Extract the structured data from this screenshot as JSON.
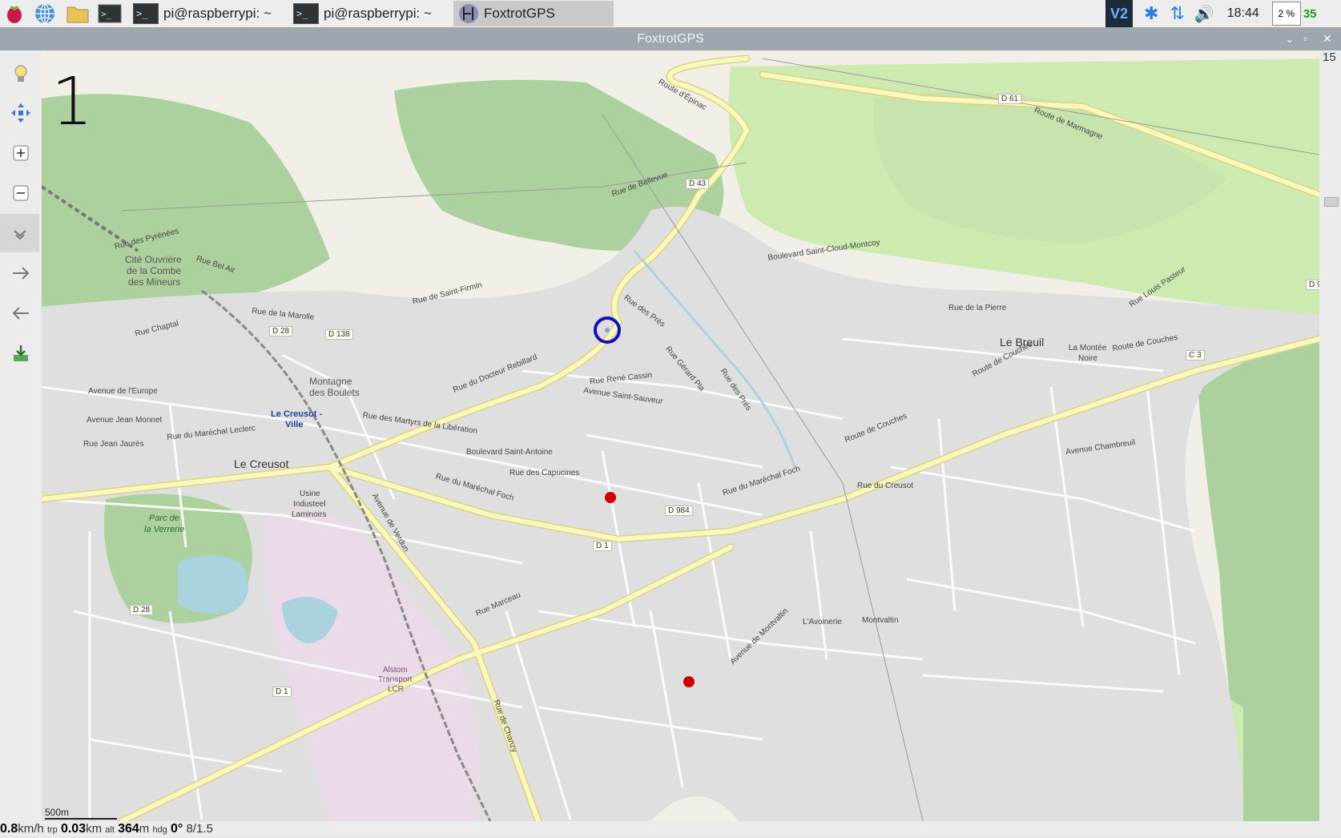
{
  "taskbar": {
    "tasks": [
      {
        "label": "pi@raspberrypi: ~"
      },
      {
        "label": "pi@raspberrypi: ~"
      },
      {
        "label": "FoxtrotGPS"
      }
    ],
    "clock": "18:44",
    "cpu": "2 %",
    "temp": "35"
  },
  "window": {
    "title": "FoxtrotGPS"
  },
  "map": {
    "zoom_level": "1",
    "scale_label": "500m",
    "right_zoom_label": "15",
    "labels": {
      "cite_ouvriere": "Cité Ouvrière",
      "de_la_combe": "de la Combe",
      "des_mineurs": "des Mineurs",
      "le_creusot_ville_1": "Le Creusot -",
      "le_creusot_ville_2": "Ville",
      "le_creusot": "Le Creusot",
      "montagne": "Montagne",
      "des_boulets": "des Boulets",
      "usine_1": "Usine",
      "usine_2": "Industeel",
      "usine_3": "Laminoirs",
      "parc_1": "Parc de",
      "parc_2": "la Verrerie",
      "alstom_1": "Alstom",
      "alstom_2": "Transport",
      "alstom_3": "LCR",
      "le_breuil": "Le Breuil",
      "la_montee_1": "La Montée",
      "la_montee_2": "Noire",
      "lavoinerie": "L'Avoinerie",
      "montvaltin": "Montvaltin",
      "rue_docteur_rebillard": "Rue du Docteur Rebillard",
      "rue_marechal_leclerc": "Rue du Maréchal Leclerc",
      "rue_marechal_foch_1": "Rue du Maréchal Foch",
      "rue_marechal_foch_2": "Rue du Maréchal Foch",
      "rue_jean_jaures": "Rue Jean Jaurès",
      "avenue_saint_sauveur": "Avenue Saint-Sauveur",
      "boulevard_saint_antoine": "Boulevard Saint-Antoine",
      "route_de_couches_1": "Route de Couches",
      "route_de_couches_2": "Route de Couches",
      "route_de_couches_3": "Route de Couches",
      "route_de_marmagne": "Route de Marmagne",
      "boulevard_saint_cloud": "Boulevard Saint-Cloud-Montcoy",
      "rue_marceau": "Rue Marceau",
      "avenue_de_verdun": "Avenue de Verdun",
      "rue_de_chanzy": "Rue de Chanzy",
      "rue_du_creusot": "Rue du Creusot",
      "avenue_de_montvaltin": "Avenue de Montvaltin",
      "rue_chaptal": "Rue Chaptal",
      "rue_des_pres_1": "Rue des Prés",
      "rue_des_pres_2": "Rue des Prés",
      "route_d_epinac": "Route d'Épinac",
      "rue_saint_firmin": "Rue de Saint-Firmin",
      "rue_de_bellevue": "Rue de Bellevue",
      "rue_de_la_marolle": "Rue de la Marolle",
      "rue_des_martyrs": "Rue des Martyrs de la Libération",
      "rue_des_capucines": "Rue des Capucines",
      "rue_rene_cassin": "Rue René Cassin",
      "avenue_jean_monnet": "Avenue Jean Monnet",
      "avenue_de_l_europe": "Avenue de l'Europe",
      "rue_bel_air": "Rue Bel Air",
      "rue_des_pyrenees": "Rue des Pyrénées",
      "rue_de_la_pierre": "Rue de la Pierre",
      "rue_louis_pasteur": "Rue Louis Pasteur",
      "avenue_chambreuil": "Avenue Chambreuil",
      "rue_gerard_pla": "Rue Gérard Pla",
      "ref_d28_a": "D 28",
      "ref_d138": "D 138",
      "ref_d43": "D 43",
      "ref_d61": "D 61",
      "ref_d984": "D 984",
      "ref_d1_a": "D 1",
      "ref_d1_b": "D 1",
      "ref_d28_b": "D 28",
      "ref_c3": "C 3",
      "ref_d9": "D 9"
    }
  },
  "status_bar": {
    "speed_value": "0.8",
    "speed_unit": "km/h",
    "trip_label": "trp",
    "trip_value": "0.03",
    "trip_unit": "km",
    "alt_label": "alt",
    "alt_value": "364",
    "alt_unit": "m",
    "hdg_label": "hdg",
    "hdg_value": "0°",
    "extra": "8/1.5"
  },
  "colors": {
    "taskbar_bg": "#ededed",
    "titlebar_bg": "#9ea7ad",
    "map_land": "#f2efe9",
    "forest": "#add19e",
    "grass": "#cdebb0",
    "residential": "#e0dfdf",
    "industrial": "#ebdbe8",
    "main_road": "#f7fabf",
    "gps_marker": "#1010c0"
  }
}
